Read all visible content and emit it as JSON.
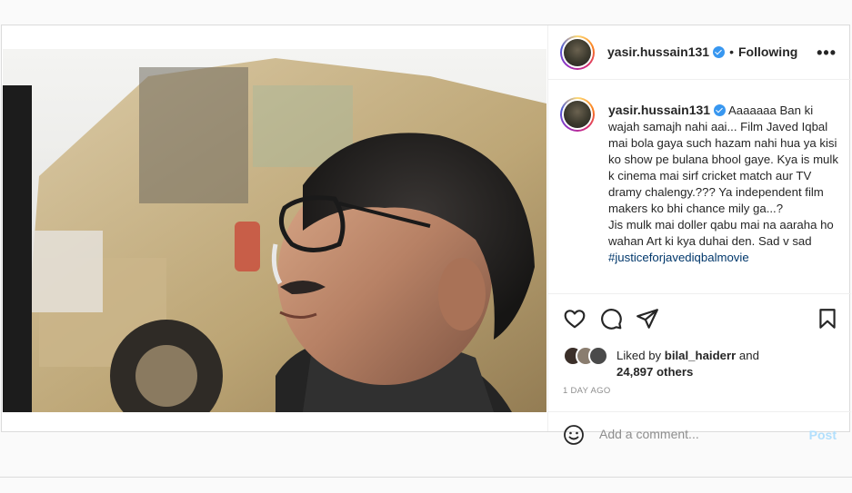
{
  "post": {
    "author": {
      "username": "yasir.hussain131",
      "verified": true,
      "follow_status": "Following",
      "separator": "•"
    },
    "menu_icon": "more-horizontal-icon",
    "caption": {
      "username": "yasir.hussain131",
      "text": "Aaaaaaa Ban ki wajah samajh nahi aai... Film Javed Iqbal mai bola gaya such hazam nahi hua ya kisi ko show pe bulana bhool gaye. Kya is mulk k cinema mai sirf cricket match aur TV dramy chalengy.??? Ya independent film makers ko bhi chance mily ga...?\nJis mulk mai doller qabu mai na aaraha ho wahan Art ki kya duhai den. Sad v sad",
      "hashtag": "#justiceforjavediqbalmovie"
    },
    "actions": {
      "like_icon": "heart-icon",
      "comment_icon": "comment-icon",
      "share_icon": "share-icon",
      "save_icon": "bookmark-icon"
    },
    "likes": {
      "prefix": "Liked by",
      "user": "bilal_haiderr",
      "connector": "and",
      "others": "24,897 others"
    },
    "timestamp": "1 DAY AGO",
    "comment_box": {
      "placeholder": "Add a comment...",
      "post_label": "Post",
      "emoji_icon": "emoji-icon"
    }
  },
  "colors": {
    "verified_badge": "#3897f0",
    "hashtag": "#00376b",
    "post_button_disabled": "#b2dffc",
    "muted_text": "#8e8e8e",
    "border": "#dbdbdb"
  }
}
